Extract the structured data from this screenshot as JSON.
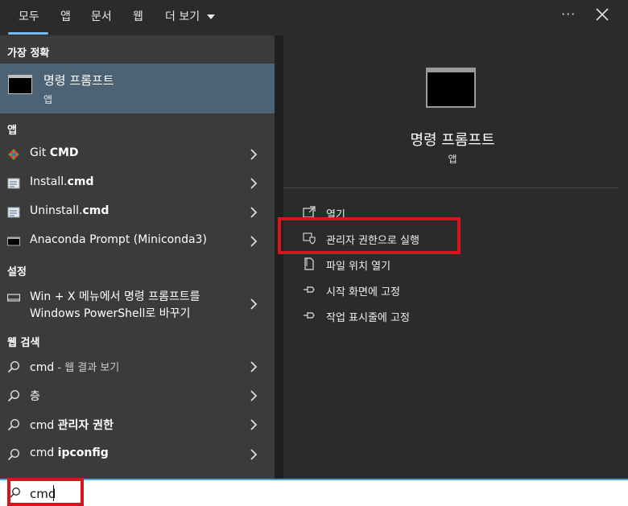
{
  "tabs": [
    "모두",
    "앱",
    "문서",
    "웹",
    "더 보기"
  ],
  "more_dots": "···",
  "left": {
    "best_match_heading": "가장 정확",
    "best_match": {
      "title": "명령 프롬프트",
      "subtitle": "앱"
    },
    "apps_heading": "앱",
    "apps": [
      {
        "prefix": "Git ",
        "bold": "CMD",
        "icon": "git-icon"
      },
      {
        "prefix": "Install.",
        "bold": "cmd",
        "icon": "script-icon"
      },
      {
        "prefix": "Uninstall.",
        "bold": "cmd",
        "icon": "script-icon"
      },
      {
        "prefix": "Anaconda Prompt (Miniconda3)",
        "bold": "",
        "icon": "terminal-icon"
      }
    ],
    "settings_heading": "설정",
    "setting_line1": "Win + X 메뉴에서 명령 프롬프트를",
    "setting_line2": "Windows PowerShell로 바꾸기",
    "web_heading": "웹 검색",
    "web": [
      {
        "prefix": "cmd",
        "dim": " - 웹 결과 보기",
        "bold": ""
      },
      {
        "prefix": "층",
        "dim": "",
        "bold": ""
      },
      {
        "prefix": "cmd ",
        "dim": "",
        "bold": "관리자 권한"
      },
      {
        "prefix": "cmd ",
        "dim": "",
        "bold": "ipconfig"
      }
    ]
  },
  "right": {
    "title": "명령 프롬프트",
    "subtitle": "앱",
    "actions": [
      {
        "label": "열기",
        "icon": "open-icon"
      },
      {
        "label": "관리자 권한으로 실행",
        "icon": "shield-icon"
      },
      {
        "label": "파일 위치 열기",
        "icon": "file-location-icon"
      },
      {
        "label": "시작 화면에 고정",
        "icon": "pin-icon"
      },
      {
        "label": "작업 표시줄에 고정",
        "icon": "pin-icon"
      }
    ]
  },
  "search": {
    "value": "cmd"
  },
  "colors": {
    "accent": "#4b9fe0",
    "highlight": "#d7151f",
    "selected": "#4c6275"
  }
}
